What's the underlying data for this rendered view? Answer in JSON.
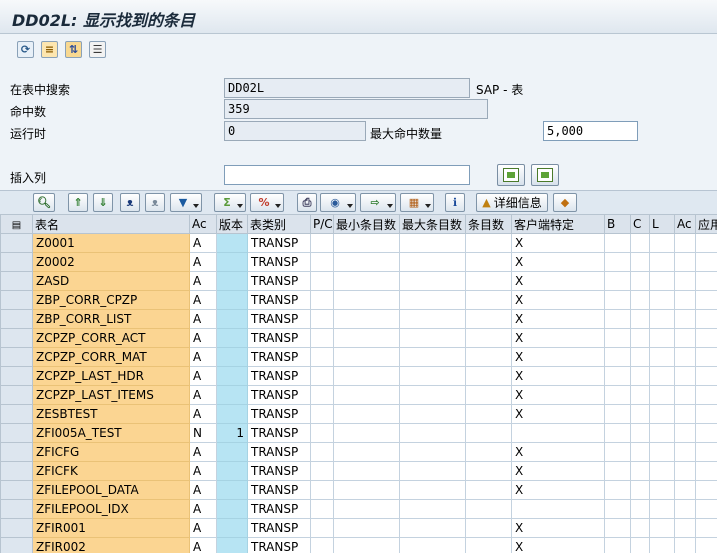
{
  "title": "DD02L: 显示找到的条目",
  "toolbar_icons": [
    "refresh-icon",
    "filter-check-icon",
    "sort-icon",
    "list-icon"
  ],
  "form": {
    "search_table_label": "在表中搜索",
    "search_table_value": "DD02L",
    "search_table_desc": "SAP - 表",
    "hits_label": "命中数",
    "hits_value": "359",
    "runtime_label": "运行时",
    "runtime_value": "0",
    "max_hits_label": "最大命中数量",
    "max_hits_value": "5,000",
    "insert_col_label": "插入列",
    "insert_col_value": ""
  },
  "alv_toolbar": {
    "detail_label": "详细信息"
  },
  "columns": [
    "表名",
    "Ac",
    "版本",
    "表类别",
    "P/C",
    "最小条目数",
    "最大条目数",
    "条目数",
    "客户端特定",
    "B",
    "C",
    "L",
    "Ac",
    "应用"
  ],
  "rows": [
    [
      "Z0001",
      "A",
      "",
      "TRANSP",
      "",
      "",
      "",
      "",
      "X"
    ],
    [
      "Z0002",
      "A",
      "",
      "TRANSP",
      "",
      "",
      "",
      "",
      "X"
    ],
    [
      "ZASD",
      "A",
      "",
      "TRANSP",
      "",
      "",
      "",
      "",
      "X"
    ],
    [
      "ZBP_CORR_CPZP",
      "A",
      "",
      "TRANSP",
      "",
      "",
      "",
      "",
      "X"
    ],
    [
      "ZBP_CORR_LIST",
      "A",
      "",
      "TRANSP",
      "",
      "",
      "",
      "",
      "X"
    ],
    [
      "ZCPZP_CORR_ACT",
      "A",
      "",
      "TRANSP",
      "",
      "",
      "",
      "",
      "X"
    ],
    [
      "ZCPZP_CORR_MAT",
      "A",
      "",
      "TRANSP",
      "",
      "",
      "",
      "",
      "X"
    ],
    [
      "ZCPZP_LAST_HDR",
      "A",
      "",
      "TRANSP",
      "",
      "",
      "",
      "",
      "X"
    ],
    [
      "ZCPZP_LAST_ITEMS",
      "A",
      "",
      "TRANSP",
      "",
      "",
      "",
      "",
      "X"
    ],
    [
      "ZESBTEST",
      "A",
      "",
      "TRANSP",
      "",
      "",
      "",
      "",
      "X"
    ],
    [
      "ZFI005A_TEST",
      "N",
      "1",
      "TRANSP",
      "",
      "",
      "",
      "",
      ""
    ],
    [
      "ZFICFG",
      "A",
      "",
      "TRANSP",
      "",
      "",
      "",
      "",
      "X"
    ],
    [
      "ZFICFK",
      "A",
      "",
      "TRANSP",
      "",
      "",
      "",
      "",
      "X"
    ],
    [
      "ZFILEPOOL_DATA",
      "A",
      "",
      "TRANSP",
      "",
      "",
      "",
      "",
      "X"
    ],
    [
      "ZFILEPOOL_IDX",
      "A",
      "",
      "TRANSP",
      "",
      "",
      "",
      "",
      ""
    ],
    [
      "ZFIR001",
      "A",
      "",
      "TRANSP",
      "",
      "",
      "",
      "",
      "X"
    ],
    [
      "ZFIR002",
      "A",
      "",
      "TRANSP",
      "",
      "",
      "",
      "",
      "X"
    ]
  ],
  "colors": {
    "key_column": "#fbd592",
    "version_column": "#b7e4f3",
    "field_bg": "#e6ecf3"
  }
}
